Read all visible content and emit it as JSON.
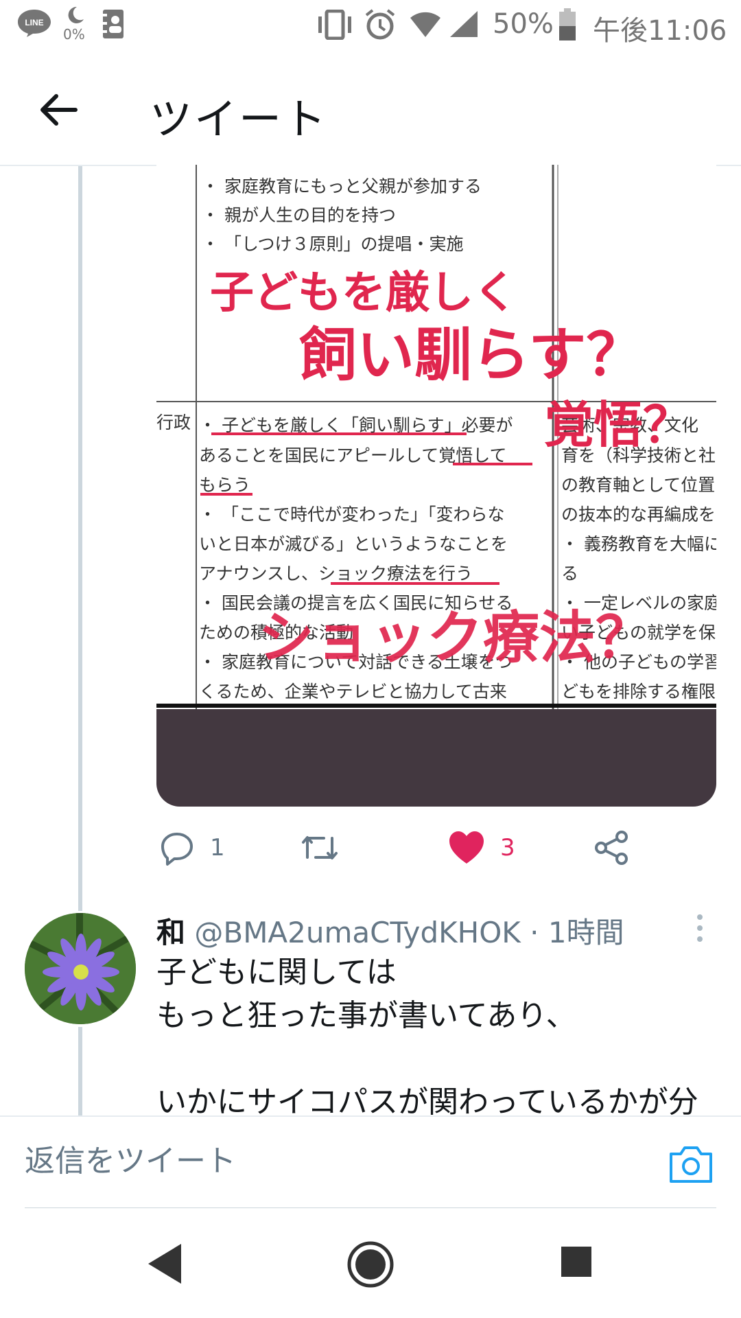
{
  "status_bar": {
    "battery_percent": "50%",
    "time": "午後11:06",
    "data_saver_text": "0%",
    "line_icon_label": "LINE",
    "icons": [
      "line-icon",
      "moon-data-icon",
      "contact-card-icon",
      "vibrate-icon",
      "alarm-icon",
      "wifi-icon",
      "signal-icon",
      "battery-icon"
    ]
  },
  "header": {
    "title": "ツイート",
    "back_icon": "back-arrow-icon"
  },
  "tweet_image": {
    "doc_lines_top": [
      "・ 家庭教育にもっと父親が参加する",
      "・ 親が人生の目的を持つ",
      "・ 「しつけ３原則」の提唱・実施"
    ],
    "doc_section_label": "行政",
    "doc_lines_bottom": [
      "・ 子どもを厳しく「飼い馴らす」必要が",
      "あることを国民にアピールして覚悟して",
      "もらう",
      "・ 「ここで時代が変わった」「変わらな",
      "いと日本が滅びる」というようなことを",
      "アナウンスし、ショック療法を行う",
      "・ 国民会議の提言を広く国民に知らせる",
      "ための積極的な活動",
      "・ 家庭教育について対話できる土壌をつ",
      "くるため、企業やテレビと協力して古来"
    ],
    "doc_lines_right": [
      "芸術、宗教、文化",
      "育を（科学技術と社",
      "の教育軸として位置",
      "の抜本的な再編成を",
      "・ 義務教育を大幅に",
      "る",
      "・ 一定レベルの家庭",
      "い子どもの就学を保",
      "・ 他の子どもの学習",
      "どもを排除する権限"
    ],
    "overlay_1": "子どもを厳しく",
    "overlay_2": "飼い馴らす？",
    "overlay_3": "覚悟？",
    "overlay_4": "ショック療法？"
  },
  "actions": {
    "reply_count": "1",
    "retweet_count": "",
    "like_count": "3",
    "colors": {
      "liked": "#e0245e",
      "muted": "#657786"
    }
  },
  "reply_tweet": {
    "name": "和",
    "handle": "@BMA2umaCTydKHOK",
    "separator": " · ",
    "time": "1時間",
    "body": "子どもに関しては\nもっと狂った事が書いてあり、\n\nいかにサイコパスが関わっているかが分"
  },
  "composer": {
    "placeholder": "返信をツイート",
    "accent": "#1da1f2"
  }
}
